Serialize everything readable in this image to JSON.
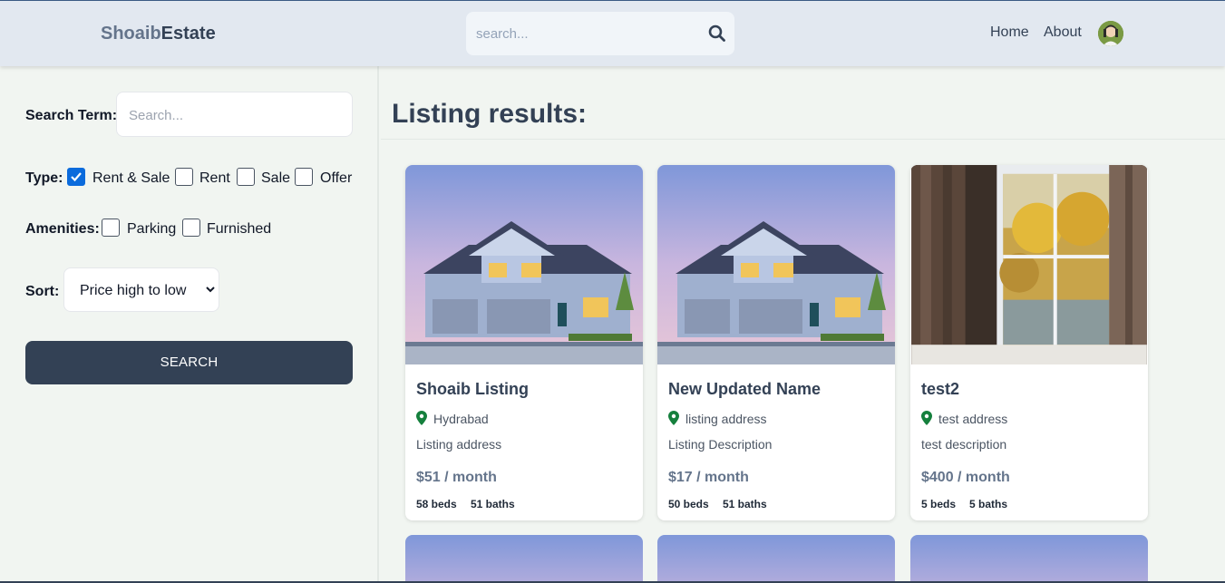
{
  "header": {
    "logo_part1": "Shoaib",
    "logo_part2": "Estate",
    "search_placeholder": "search...",
    "nav": {
      "home": "Home",
      "about": "About"
    }
  },
  "sidebar": {
    "search_term_label": "Search Term:",
    "search_term_placeholder": "Search...",
    "type_label": "Type:",
    "type_options": [
      {
        "label": "Rent & Sale",
        "checked": true
      },
      {
        "label": "Rent",
        "checked": false
      },
      {
        "label": "Sale",
        "checked": false
      },
      {
        "label": "Offer",
        "checked": false
      }
    ],
    "amenities_label": "Amenities:",
    "amenities_options": [
      {
        "label": "Parking",
        "checked": false
      },
      {
        "label": "Furnished",
        "checked": false
      }
    ],
    "sort_label": "Sort:",
    "sort_value": "Price high to low",
    "search_button": "SEARCH"
  },
  "main": {
    "title": "Listing results:",
    "listings": [
      {
        "name": "Shoaib Listing",
        "address": "Hydrabad",
        "description": "Listing address",
        "price": "$51 / month",
        "beds": "58 beds",
        "baths": "51 baths",
        "image": "house-photo"
      },
      {
        "name": "New Updated Name",
        "address": "listing address",
        "description": "Listing Description",
        "price": "$17 / month",
        "beds": "50 beds",
        "baths": "51 baths",
        "image": "house-photo"
      },
      {
        "name": "test2",
        "address": "test address",
        "description": "test description",
        "price": "$400 / month",
        "beds": "5 beds",
        "baths": "5 baths",
        "image": "window-photo"
      }
    ]
  },
  "colors": {
    "header_bg": "#e2e8f0",
    "page_bg": "#f1f5f1",
    "button_bg": "#334155",
    "checkbox_checked": "#0b6bdc",
    "location_icon": "#15803d"
  }
}
